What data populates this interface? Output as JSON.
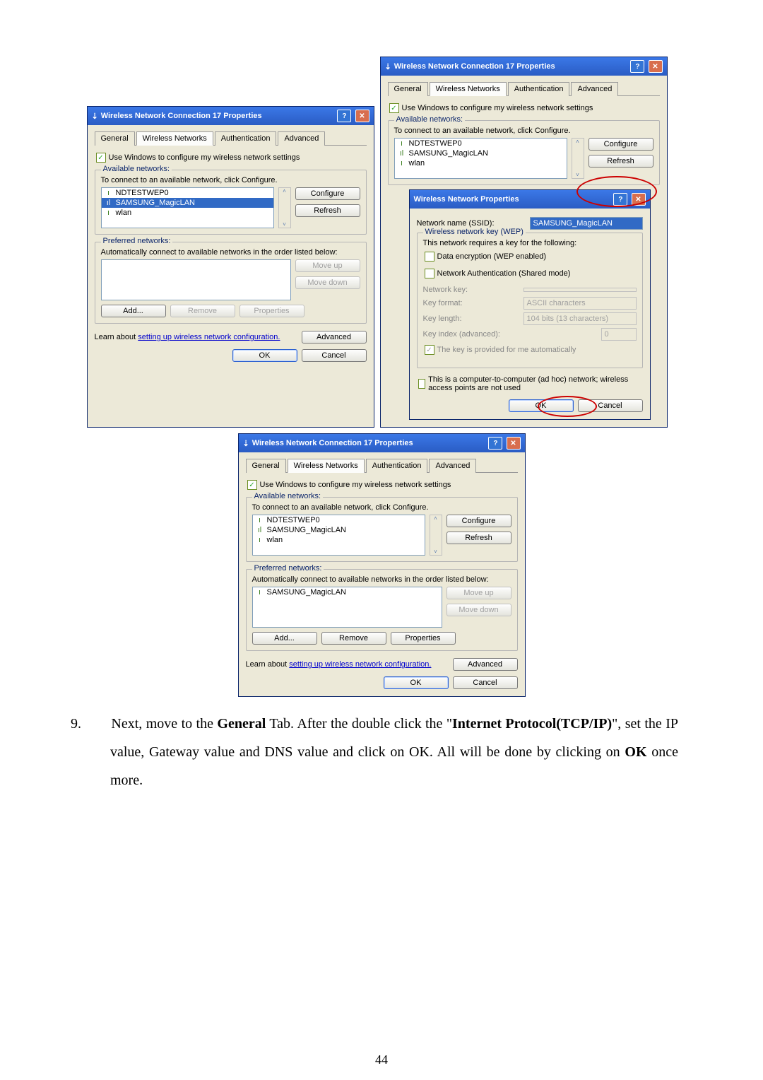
{
  "dialog1": {
    "title": "Wireless Network Connection 17 Properties",
    "tabs": [
      "General",
      "Wireless Networks",
      "Authentication",
      "Advanced"
    ],
    "active_tab": 1,
    "use_windows_label": "Use Windows to configure my wireless network settings",
    "available": {
      "title": "Available networks:",
      "desc": "To connect to an available network, click Configure.",
      "items": [
        "NDTESTWEP0",
        "SAMSUNG_MagicLAN",
        "wlan"
      ],
      "selected_index": 1,
      "configure": "Configure",
      "refresh": "Refresh"
    },
    "preferred": {
      "title": "Preferred networks:",
      "desc": "Automatically connect to available networks in the order listed below:",
      "moveup": "Move up",
      "movedown": "Move down",
      "add": "Add...",
      "remove": "Remove",
      "properties": "Properties"
    },
    "learn": "Learn about ",
    "learn_link": "setting up wireless network configuration.",
    "advanced": "Advanced",
    "ok": "OK",
    "cancel": "Cancel"
  },
  "dialog2": {
    "title": "Wireless Network Connection 17 Properties",
    "shows_nested": true
  },
  "wepdlg": {
    "title": "Wireless Network Properties",
    "ssid_label": "Network name (SSID):",
    "ssid_value": "SAMSUNG_MagicLAN",
    "group_title": "Wireless network key (WEP)",
    "requires": "This network requires a key for the following:",
    "data_enc": "Data encryption (WEP enabled)",
    "net_auth": "Network Authentication (Shared mode)",
    "net_key": "Network key:",
    "key_format": "Key format:",
    "key_format_val": "ASCII characters",
    "key_length": "Key length:",
    "key_length_val": "104 bits (13 characters)",
    "key_index": "Key index (advanced):",
    "key_index_val": "0",
    "auto_key": "The key is provided for me automatically",
    "adhoc": "This is a computer-to-computer (ad hoc) network; wireless access points are not used",
    "ok": "OK",
    "cancel": "Cancel"
  },
  "dialog3": {
    "preferred_item": "SAMSUNG_MagicLAN"
  },
  "body": {
    "num": "9.",
    "text_a": "Next, move to the ",
    "general": "General",
    "text_b": " Tab. After the double click the \"",
    "internet": "Internet Protocol(TCP/IP)",
    "text_c": "\", set the IP value, Gateway value and DNS value and click on OK. All will be done by clicking  on ",
    "ok_bold": "OK",
    "text_d": " once more."
  },
  "pagenum": "44"
}
